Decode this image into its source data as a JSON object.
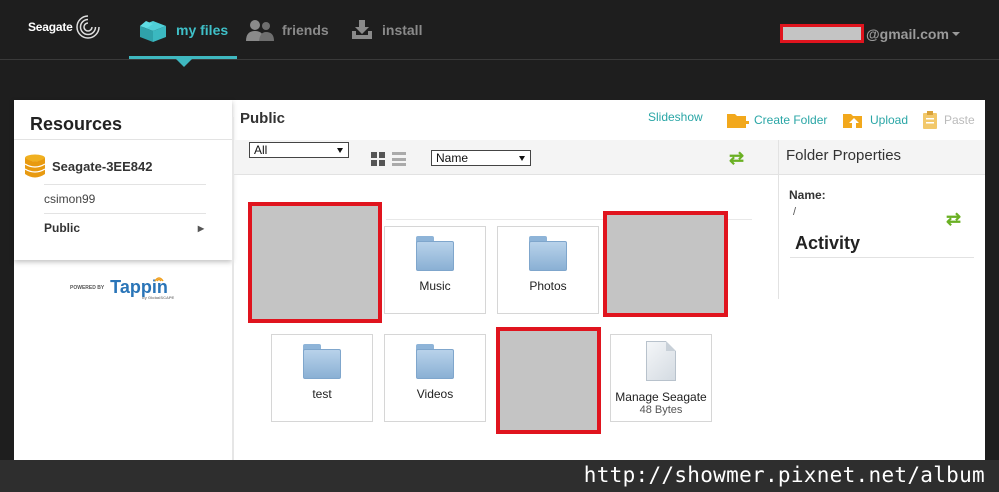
{
  "header": {
    "brand": "Seagate",
    "nav": [
      {
        "label": "my files",
        "icon": "box-icon",
        "active": true
      },
      {
        "label": "friends",
        "icon": "people-icon",
        "active": false
      },
      {
        "label": "install",
        "icon": "download-icon",
        "active": false
      }
    ],
    "account_suffix": "@gmail.com"
  },
  "sidebar": {
    "title": "Resources",
    "device": "Seagate-3EE842",
    "items": [
      {
        "label": "csimon99"
      },
      {
        "label": "Public",
        "arrow": "▶"
      }
    ],
    "powered_by": "POWERED BY",
    "partner": "Tappin",
    "partner_sub": "by GlobalSCAPE"
  },
  "content": {
    "breadcrumb": "Public",
    "actions": {
      "slideshow": "Slideshow",
      "create_folder": "Create Folder",
      "upload": "Upload",
      "paste": "Paste"
    },
    "filter_select": "All",
    "sort_select": "Name",
    "tiles": [
      {
        "label": "Music",
        "type": "folder"
      },
      {
        "label": "Photos",
        "type": "folder"
      },
      {
        "label": "test",
        "type": "folder"
      },
      {
        "label": "Videos",
        "type": "folder"
      },
      {
        "label": "Manage Seagate",
        "size": "48 Bytes",
        "type": "file"
      }
    ]
  },
  "properties": {
    "title": "Folder Properties",
    "name_label": "Name:",
    "name_value": "/",
    "activity_title": "Activity"
  },
  "watermark": "http://showmer.pixnet.net/album",
  "colors": {
    "accent": "#3fb8c0",
    "action_link": "#2aa6a6",
    "refresh": "#6ab023",
    "redaction_border": "#e0141e"
  }
}
